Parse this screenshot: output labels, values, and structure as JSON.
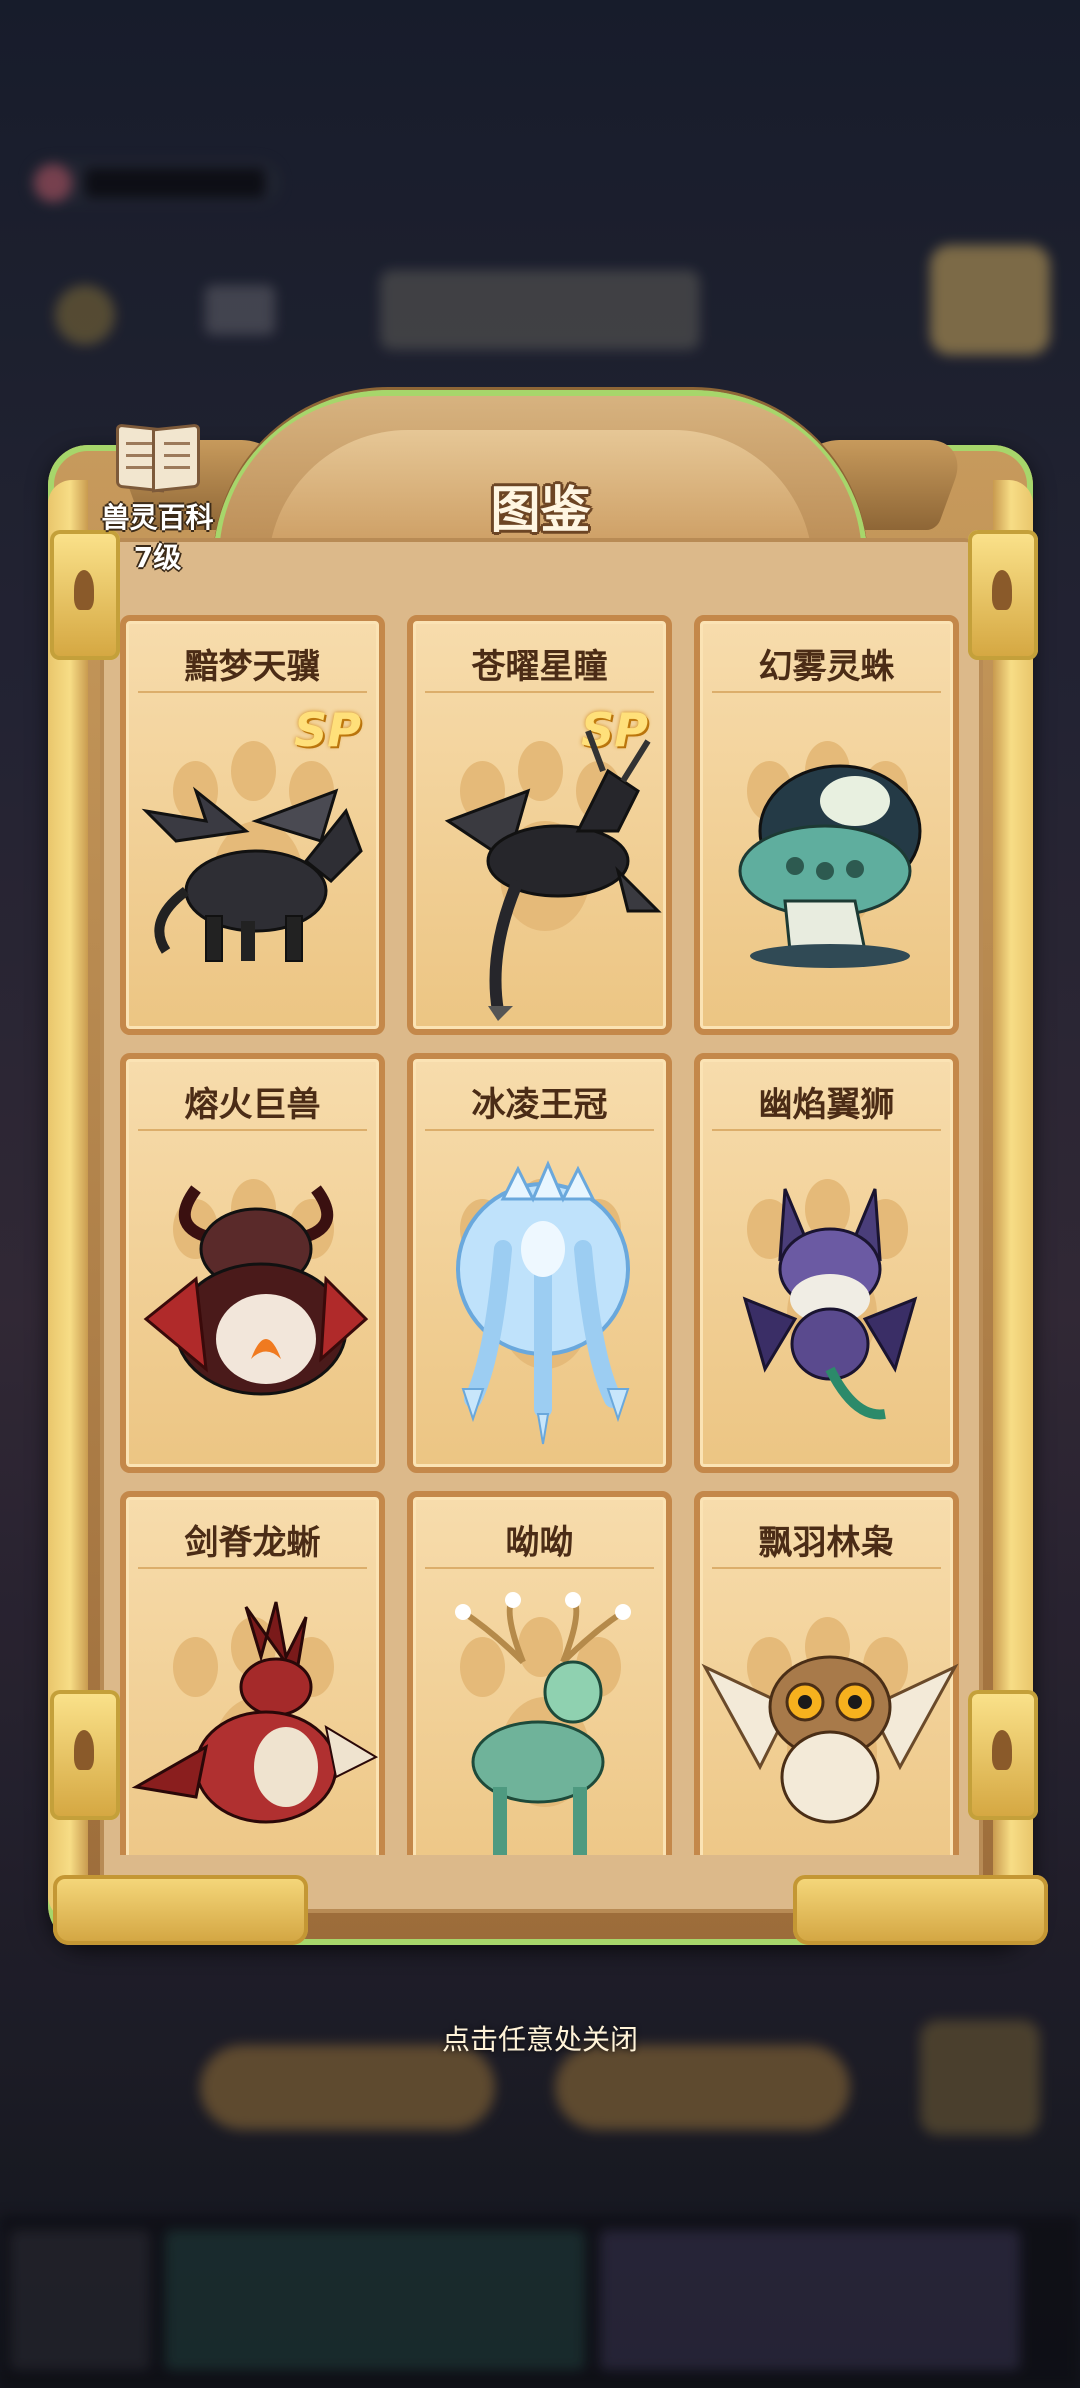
{
  "panel": {
    "title": "图鉴"
  },
  "book": {
    "label": "兽灵百科",
    "level": "7级"
  },
  "cards": [
    {
      "name": "黯梦天骥",
      "sp": "SP",
      "icon": "dark-pegasus-icon",
      "accent": "#2e2e34"
    },
    {
      "name": "苍曜星瞳",
      "sp": "SP",
      "icon": "dark-dragon-icon",
      "accent": "#26262b"
    },
    {
      "name": "幻雾灵蛛",
      "sp": "",
      "icon": "mushroom-spider-icon",
      "accent": "#5fae9e"
    },
    {
      "name": "熔火巨兽",
      "sp": "",
      "icon": "lava-beast-icon",
      "accent": "#7a1c1c"
    },
    {
      "name": "冰凌王冠",
      "sp": "",
      "icon": "ice-crown-spirit-icon",
      "accent": "#8fc6f0"
    },
    {
      "name": "幽焰翼狮",
      "sp": "",
      "icon": "shadow-winged-lion-icon",
      "accent": "#6b5aa3"
    },
    {
      "name": "剑脊龙蜥",
      "sp": "",
      "icon": "crimson-dragon-icon",
      "accent": "#a52a2a"
    },
    {
      "name": "呦呦",
      "sp": "",
      "icon": "flower-deer-icon",
      "accent": "#6fb39a"
    },
    {
      "name": "飘羽林枭",
      "sp": "",
      "icon": "forest-owl-icon",
      "accent": "#a87a4a"
    }
  ],
  "hint": "点击任意处关闭"
}
